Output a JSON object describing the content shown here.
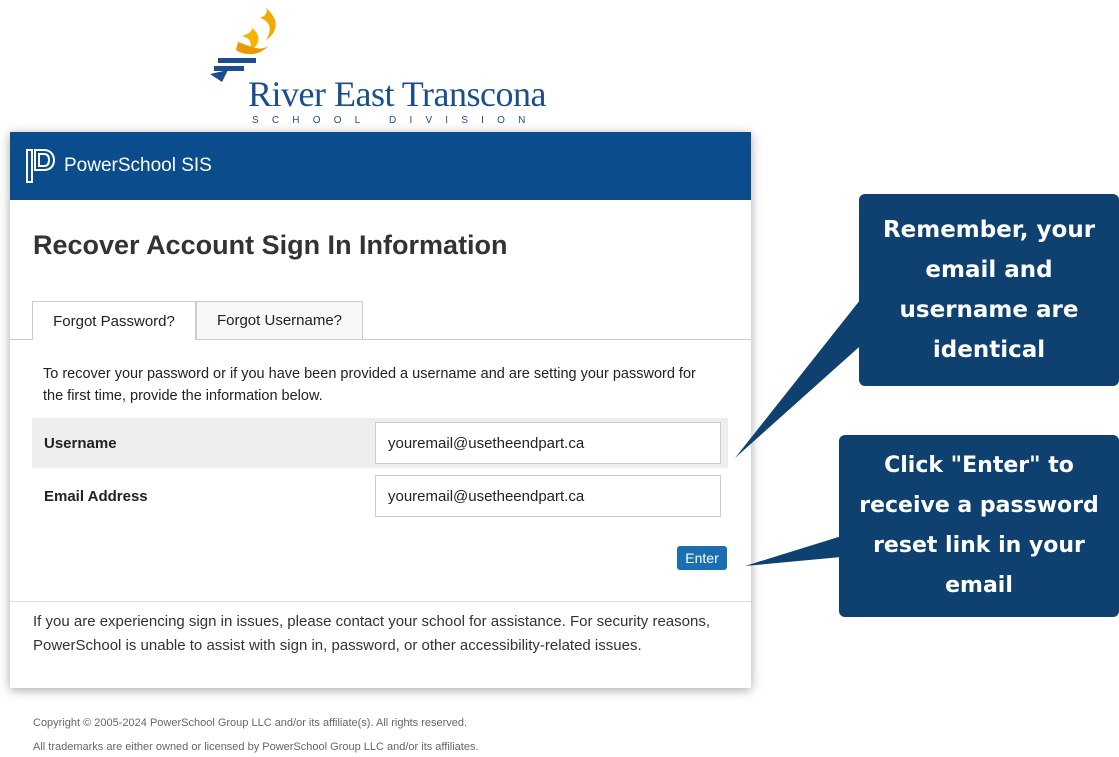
{
  "logo": {
    "name": "River East Transcona",
    "subtitle": "SCHOOL DIVISION"
  },
  "header": {
    "app_name": "PowerSchool SIS",
    "logo_icon": "powerschool-logo-icon"
  },
  "page": {
    "title": "Recover Account Sign In Information"
  },
  "tabs": [
    {
      "label": "Forgot Password?",
      "active": true
    },
    {
      "label": "Forgot Username?",
      "active": false
    }
  ],
  "form": {
    "instructions": "To recover your password or if you have been provided a username and are setting your password for the first time, provide the information below.",
    "username_label": "Username",
    "username_value": "youremail@usetheendpart.ca",
    "email_label": "Email Address",
    "email_value": "youremail@usetheendpart.ca",
    "enter_label": "Enter"
  },
  "support_note": "If you are experiencing sign in issues, please contact your school for assistance. For security reasons, PowerSchool is unable to assist with sign in, password, or other accessibility-related issues.",
  "footer": {
    "copyright": "Copyright © 2005-2024 PowerSchool Group LLC and/or its affiliate(s). All rights reserved.",
    "trademarks": "All trademarks are either owned or licensed by PowerSchool Group LLC and/or its affiliates."
  },
  "callouts": {
    "first": "Remember, your email and username are identical",
    "second": "Click \"Enter\" to receive a password reset link in your email"
  },
  "colors": {
    "header_blue": "#0b4c8c",
    "callout_navy": "#0e4170",
    "button_blue": "#1a6fb0",
    "logo_gold": "#f2a900"
  }
}
